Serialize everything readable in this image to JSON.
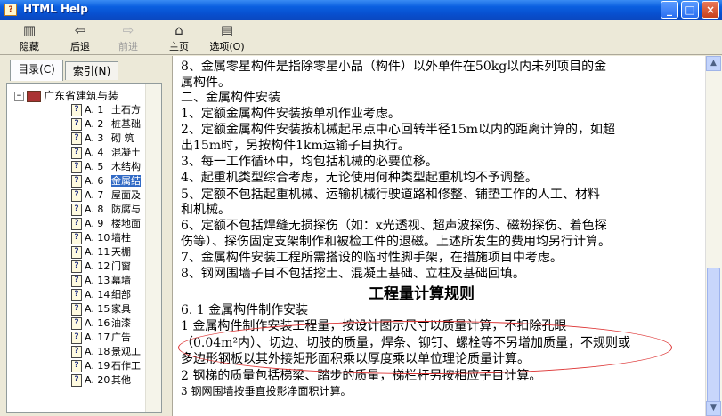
{
  "window": {
    "title": "HTML Help",
    "icon_letter": "?"
  },
  "window_buttons": {
    "minimize": "_",
    "maximize": "□",
    "close": "×"
  },
  "toolbar": {
    "hide": "隐藏",
    "back": "后退",
    "forward": "前进",
    "home": "主页",
    "options": "选项(O)",
    "icons": [
      "hide-icon",
      "back-icon",
      "forward-icon",
      "home-icon",
      "options-icon"
    ]
  },
  "tabs": {
    "contents": "目录(C)",
    "index": "索引(N)"
  },
  "tree": {
    "root": "广东省建筑与装",
    "items": [
      {
        "code": "A. 1",
        "label": "土石方"
      },
      {
        "code": "A. 2",
        "label": "桩基础"
      },
      {
        "code": "A. 3",
        "label": "砌 筑"
      },
      {
        "code": "A. 4",
        "label": "混凝土"
      },
      {
        "code": "A. 5",
        "label": "木结构"
      },
      {
        "code": "A. 6",
        "label": "金属结"
      },
      {
        "code": "A. 7",
        "label": "屋面及"
      },
      {
        "code": "A. 8",
        "label": "防腐与"
      },
      {
        "code": "A. 9",
        "label": "楼地面"
      },
      {
        "code": "A. 10",
        "label": "墙柱"
      },
      {
        "code": "A. 11",
        "label": "天棚"
      },
      {
        "code": "A. 12",
        "label": "门窗"
      },
      {
        "code": "A. 13",
        "label": "幕墙"
      },
      {
        "code": "A. 14",
        "label": "细部"
      },
      {
        "code": "A. 15",
        "label": "家具"
      },
      {
        "code": "A. 16",
        "label": "油漆"
      },
      {
        "code": "A. 17",
        "label": "广告"
      },
      {
        "code": "A. 18",
        "label": "景观工"
      },
      {
        "code": "A. 19",
        "label": "石作工"
      },
      {
        "code": "A. 20",
        "label": "其他"
      }
    ],
    "selected_index": 5
  },
  "content": {
    "lines": [
      "    8、金属零星构件是指除零星小品（构件）以外单件在50kg以内未列项目的金",
      "属构件。",
      "    二、金属构件安装",
      "    1、定额金属构件安装按单机作业考虑。",
      "    2、定额金属构件安装按机械起吊点中心回转半径15m以内的距离计算的，如超",
      "出15m时，另按构件1km运输子目执行。",
      "    3、每一工作循环中，均包括机械的必要位移。",
      "    4、起重机类型综合考虑，无论使用何种类型起重机均不予调整。",
      "    5、定额不包括起重机械、运输机械行驶道路和修整、铺垫工作的人工、材料",
      "和机械。",
      "    6、定额不包括焊缝无损探伤（如：x光透视、超声波探伤、磁粉探伤、着色探",
      "伤等）、探伤固定支架制作和被检工件的退磁。上述所发生的费用均另行计算。",
      "    7、金属构件安装工程所需搭设的临时性脚手架，在措施项目中考虑。",
      "    8、钢网围墙子目不包括挖土、混凝土基础、立柱及基础回填。"
    ],
    "heading": "工程量计算规则",
    "section": "6. 1  金属构件制作安装",
    "rules": [
      "    1  金属构件制作安装工程量，按设计图示尺寸以质量计算，不扣除孔眼",
      "（0.04m²内）、切边、切肢的质量，焊条、铆钉、螺栓等不另增加质量，不规则或",
      "多边形钢板以其外接矩形面积乘以厚度乘以单位理论质量计算。",
      "    2  钢梯的质量包括梯梁、踏步的质量，梯栏杆另按相应子目计算。",
      "  3 钢网围墙按垂直投影净面积计算。"
    ]
  },
  "scrollbar": {
    "up_arrow": "▲",
    "down_arrow": "▼"
  },
  "annotation_color": "#dd3333"
}
